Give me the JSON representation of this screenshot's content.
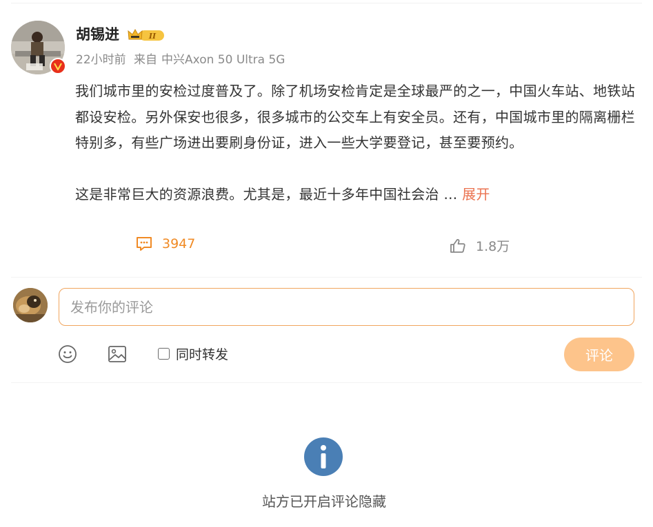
{
  "post": {
    "author": "胡锡进",
    "time": "22小时前",
    "source_prefix": "来自",
    "source_device": "中兴Axon 50 Ultra 5G",
    "paragraph1": "我们城市里的安检过度普及了。除了机场安检肯定是全球最严的之一，中国火车站、地铁站都设安检。另外保安也很多，很多城市的公交车上有安全员。还有，中国城市里的隔离栅栏特别多，有些广场进出要刷身份证，进入一些大学要登记，甚至要预约。",
    "paragraph2": "这是非常巨大的资源浪费。尤其是，最近十多年中国社会治",
    "ellipsis": " ... ",
    "expand_label": "展开",
    "level_badge": "II"
  },
  "actions": {
    "comments_count": "3947",
    "likes_count": "1.8万"
  },
  "composer": {
    "placeholder": "发布你的评论",
    "repost_label": "同时转发",
    "submit_label": "评论"
  },
  "notice": {
    "text": "站方已开启评论隐藏"
  },
  "colors": {
    "accent_orange": "#f08a24",
    "expand_link": "#eb7350",
    "submit_bg": "#fdc48b",
    "input_border": "#f0a45d",
    "info_icon": "#4a7fb5",
    "verify_badge": "#e8301b"
  },
  "icons": {
    "comment": "comment-bubble-icon",
    "like": "thumbs-up-icon",
    "emoji": "smiley-icon",
    "image": "image-icon",
    "info": "info-icon",
    "verified": "verified-v-icon",
    "level": "crown-level-icon"
  }
}
